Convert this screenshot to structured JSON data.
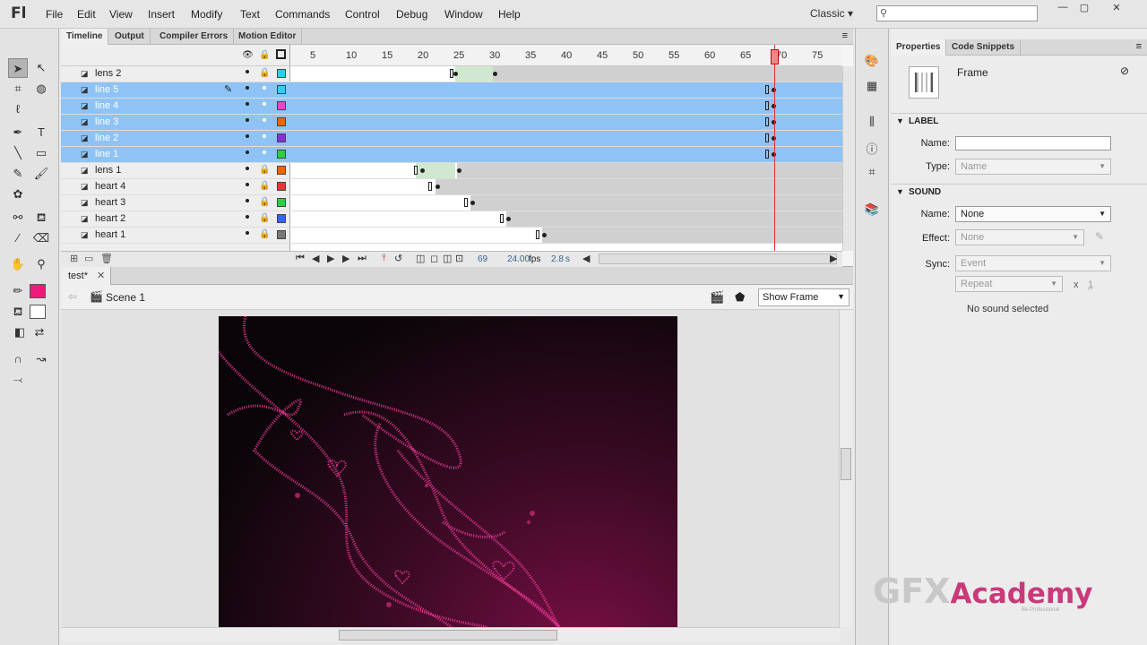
{
  "app": {
    "logo": "Fl",
    "menu": [
      "File",
      "Edit",
      "View",
      "Insert",
      "Modify",
      "Text",
      "Commands",
      "Control",
      "Debug",
      "Window",
      "Help"
    ],
    "workspace": "Classic"
  },
  "panel_tabs": [
    "Timeline",
    "Output",
    "Compiler Errors",
    "Motion Editor"
  ],
  "timeline": {
    "ruler_labels": [
      "5",
      "10",
      "15",
      "20",
      "25",
      "30",
      "35",
      "40",
      "45",
      "50",
      "55",
      "60",
      "65",
      "70",
      "75"
    ],
    "layers": [
      {
        "name": "lens 2",
        "color": "#33ccee",
        "selected": false
      },
      {
        "name": "line 5",
        "color": "#33ccee",
        "selected": true
      },
      {
        "name": "line 4",
        "color": "#ee44cc",
        "selected": true
      },
      {
        "name": "line 3",
        "color": "#ee6600",
        "selected": true
      },
      {
        "name": "line 2",
        "color": "#8833cc",
        "selected": true
      },
      {
        "name": "line 1",
        "color": "#33cc44",
        "selected": true
      },
      {
        "name": "lens 1",
        "color": "#ee6600",
        "selected": false
      },
      {
        "name": "heart 4",
        "color": "#ee3333",
        "selected": false
      },
      {
        "name": "heart 3",
        "color": "#33cc44",
        "selected": false
      },
      {
        "name": "heart 2",
        "color": "#3366ee",
        "selected": false
      },
      {
        "name": "heart 1",
        "color": "#777777",
        "selected": false
      }
    ],
    "current_frame": "69",
    "fps": "24.00",
    "fps_unit": "fps",
    "elapsed": "2.8",
    "elapsed_unit": "s"
  },
  "document": {
    "tab": "test*",
    "scene": "Scene 1",
    "zoom": "Show Frame"
  },
  "properties": {
    "tabs": [
      "Properties",
      "Code Snippets"
    ],
    "type_label": "Frame",
    "label_section": "LABEL",
    "name_label": "Name:",
    "type_field_label": "Type:",
    "type_value": "Name",
    "sound_section": "SOUND",
    "sound_name_label": "Name:",
    "sound_name_value": "None",
    "effect_label": "Effect:",
    "effect_value": "None",
    "sync_label": "Sync:",
    "sync_value": "Event",
    "repeat_value": "Repeat",
    "repeat_x": "x",
    "repeat_count": "1",
    "no_sound": "No sound selected"
  },
  "watermark": {
    "gfx": "GFX",
    "academy": "Academy",
    "sub": "Be Professional"
  }
}
